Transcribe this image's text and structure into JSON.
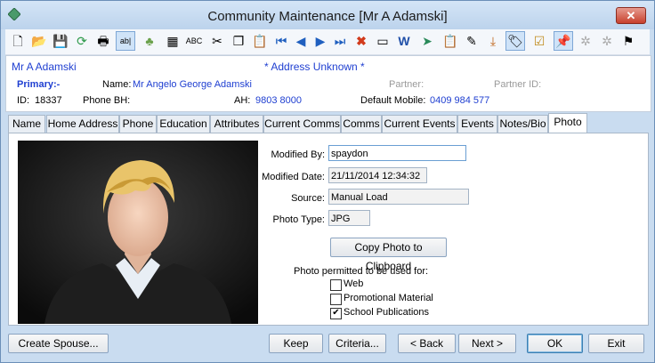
{
  "window": {
    "title": "Community Maintenance  [Mr A Adamski]",
    "close_label": "✕"
  },
  "toolbar": {
    "icons": [
      "new-icon",
      "open-icon",
      "save-icon",
      "refresh-icon",
      "print-icon",
      "text-field-icon",
      "tree-icon",
      "calculator-icon",
      "spellcheck-icon",
      "cut-icon",
      "copy-icon",
      "paste-icon",
      "first-record-icon",
      "previous-record-icon",
      "next-record-icon",
      "last-record-icon",
      "delete-icon",
      "card-icon",
      "word-icon",
      "send-icon",
      "clipboard-list-icon",
      "sign-icon",
      "download-icon",
      "tag-icon",
      "checklist-icon",
      "pin-icon",
      "group-icon",
      "people-icon",
      "flag-icon"
    ]
  },
  "header": {
    "name": "Mr A Adamski",
    "address_status": "* Address Unknown *",
    "primary_label": "Primary:-",
    "name_label": "Name:",
    "full_name": "Mr Angelo George Adamski",
    "partner_label": "Partner:",
    "partner_id_label": "Partner ID:",
    "id_label": "ID:",
    "id_value": "18337",
    "phone_bh_label": "Phone BH:",
    "ah_label": "AH:",
    "ah_value": "9803 8000",
    "mobile_label": "Default Mobile:",
    "mobile_value": "0409 984 577"
  },
  "tabs": [
    "Name",
    "Home Address",
    "Phone",
    "Education",
    "Attributes",
    "Current Comms",
    "Comms",
    "Current Events",
    "Events",
    "Notes/Bio",
    "Photo"
  ],
  "selected_tab": "Photo",
  "photo_tab": {
    "modified_by_label": "Modified By:",
    "modified_by": "spaydon",
    "modified_date_label": "Modified Date:",
    "modified_date": "21/11/2014 12:34:32",
    "source_label": "Source:",
    "source": "Manual Load",
    "photo_type_label": "Photo Type:",
    "photo_type": "JPG",
    "copy_button": "Copy Photo to Clipboard",
    "permitted_label": "Photo permitted to be used for:",
    "options": [
      {
        "label": "Web",
        "checked": false
      },
      {
        "label": "Promotional Material",
        "checked": false
      },
      {
        "label": "School Publications",
        "checked": true
      }
    ]
  },
  "footer": {
    "create_spouse": "Create Spouse...",
    "keep": "Keep",
    "criteria": "Criteria...",
    "back": "< Back",
    "next": "Next >",
    "ok": "OK",
    "exit": "Exit"
  },
  "colors": {
    "accent_blue": "#1f3fd1",
    "title_bg": "#c9dcf0",
    "muted_label": "#9a9a9a"
  }
}
